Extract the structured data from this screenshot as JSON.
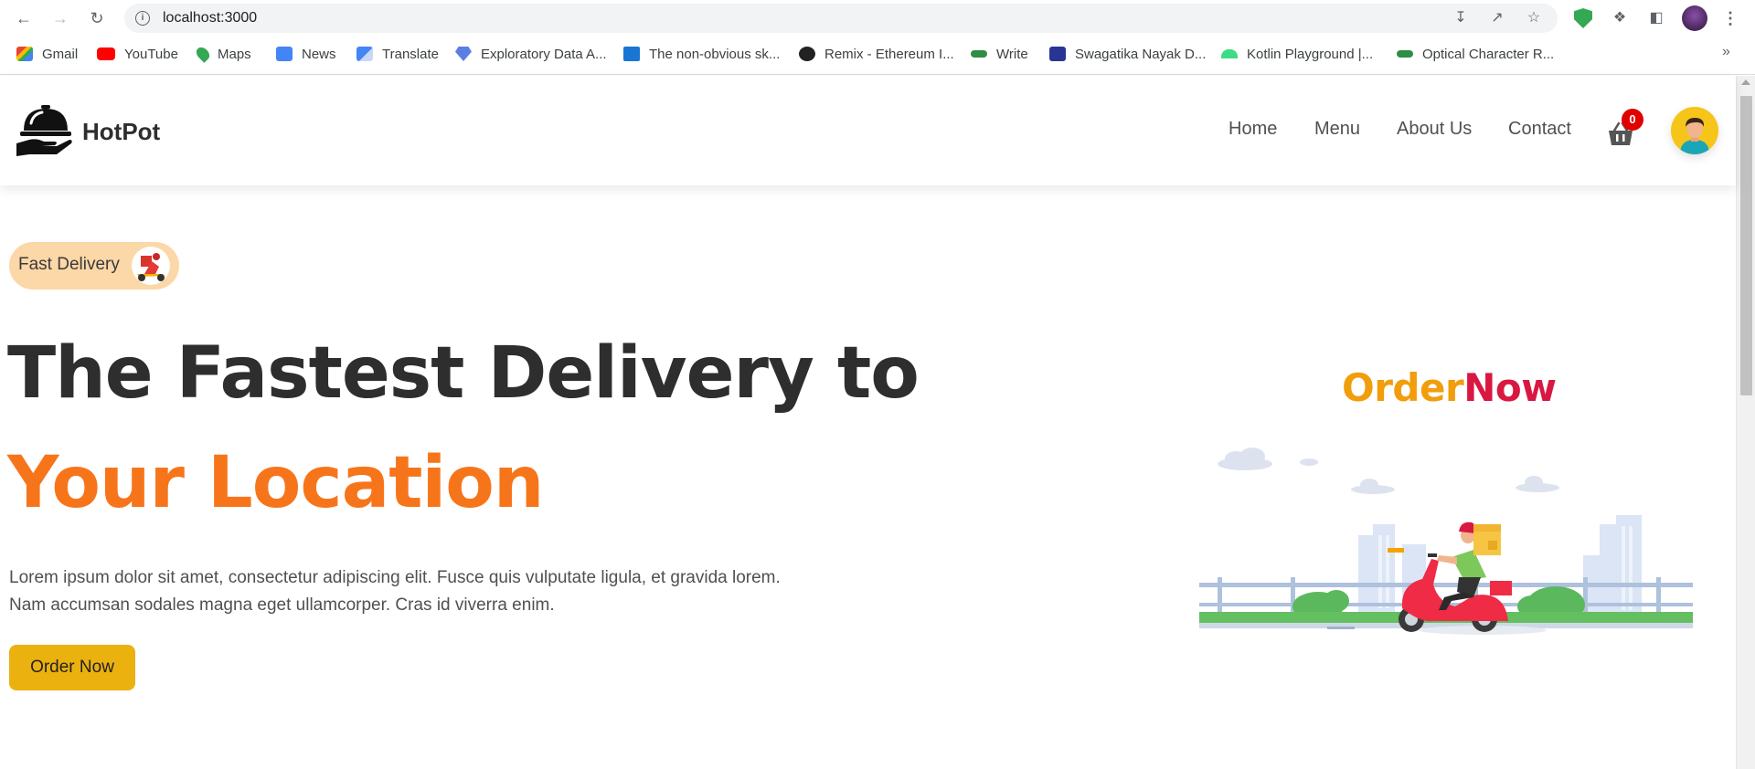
{
  "browser": {
    "url": "localhost:3000",
    "bookmarks": [
      {
        "label": "Gmail",
        "icon": "gmail-icon",
        "color": "#d93025"
      },
      {
        "label": "YouTube",
        "icon": "youtube-icon",
        "color": "#ff0000"
      },
      {
        "label": "Maps",
        "icon": "maps-icon",
        "color": "#34a853"
      },
      {
        "label": "News",
        "icon": "news-icon",
        "color": "#4285f4"
      },
      {
        "label": "Translate",
        "icon": "translate-icon",
        "color": "#4285f4"
      },
      {
        "label": "Exploratory Data A...",
        "icon": "diamond-icon",
        "color": "#5b7ee5"
      },
      {
        "label": "The non-obvious sk...",
        "icon": "play-icon",
        "color": "#1976d2"
      },
      {
        "label": "Remix - Ethereum I...",
        "icon": "remix-icon",
        "color": "#222222"
      },
      {
        "label": "Write",
        "icon": "gfg-icon",
        "color": "#2f8d46"
      },
      {
        "label": "Swagatika Nayak D...",
        "icon": "c-icon",
        "color": "#283593"
      },
      {
        "label": "Kotlin Playground  |...",
        "icon": "android-icon",
        "color": "#3ddc84"
      },
      {
        "label": "Optical Character R...",
        "icon": "gfg-icon",
        "color": "#2f8d46"
      }
    ]
  },
  "header": {
    "brand": "HotPot",
    "nav": [
      "Home",
      "Menu",
      "About Us",
      "Contact"
    ],
    "cart_count": "0"
  },
  "hero": {
    "badge": "Fast Delivery",
    "title_line1": "The Fastest Delivery to",
    "title_line2": "Your Location",
    "description_line1": "Lorem ipsum dolor sit amet, consectetur adipiscing elit. Fusce quis vulputate ligula, et gravida lorem.",
    "description_line2": "Nam accumsan sodales magna eget ullamcorper. Cras id viverra enim.",
    "cta": "Order Now",
    "illustration_word_1": "Order",
    "illustration_word_2": "Now"
  },
  "colors": {
    "accent_orange": "#f7751a",
    "button_yellow": "#ebb10f",
    "badge_bg": "#fcd7a7",
    "order_color": "#f29d0b",
    "now_color": "#d91842"
  }
}
